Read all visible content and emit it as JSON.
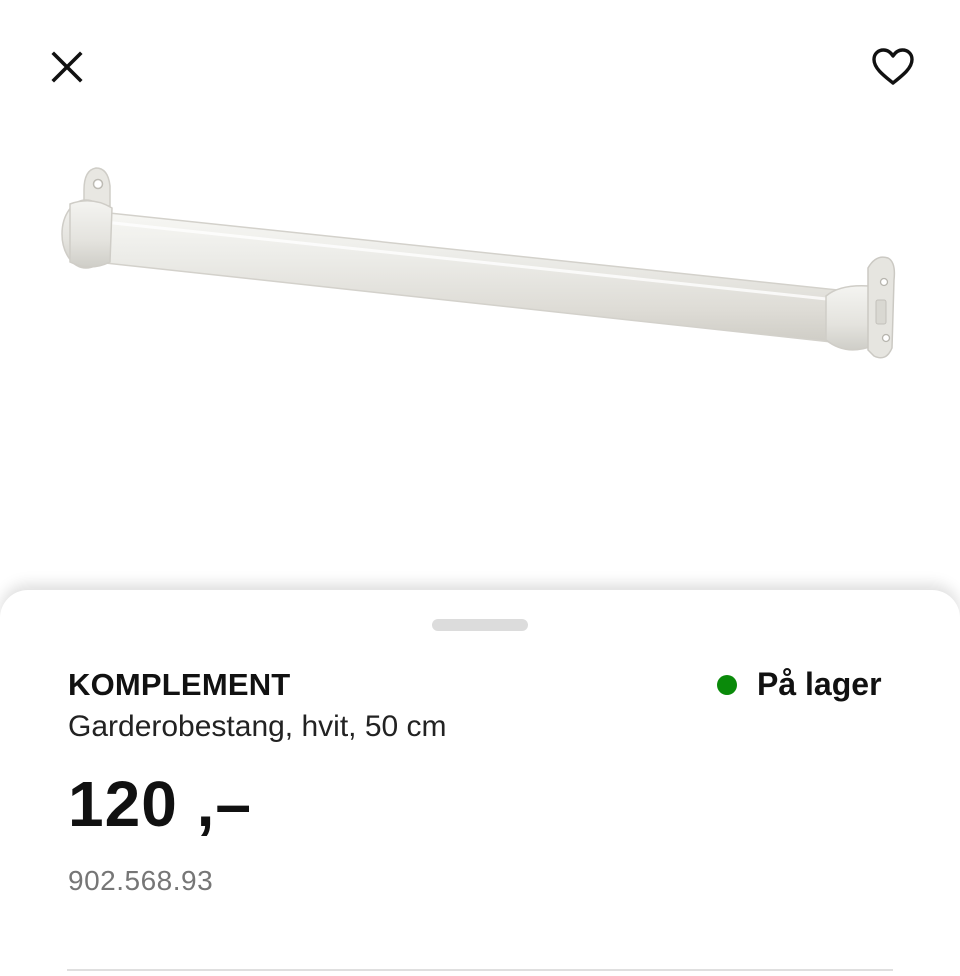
{
  "header": {
    "close_icon": "close-icon",
    "favorite_icon": "heart-outline-icon"
  },
  "product": {
    "image": "clothes-rail-image",
    "name": "KOMPLEMENT",
    "description": "Garderobestang, hvit, 50 cm",
    "price": "120 ,–",
    "article_number": "902.568.93",
    "stock": {
      "label": "På lager",
      "status_color": "#0a8a0a"
    }
  }
}
